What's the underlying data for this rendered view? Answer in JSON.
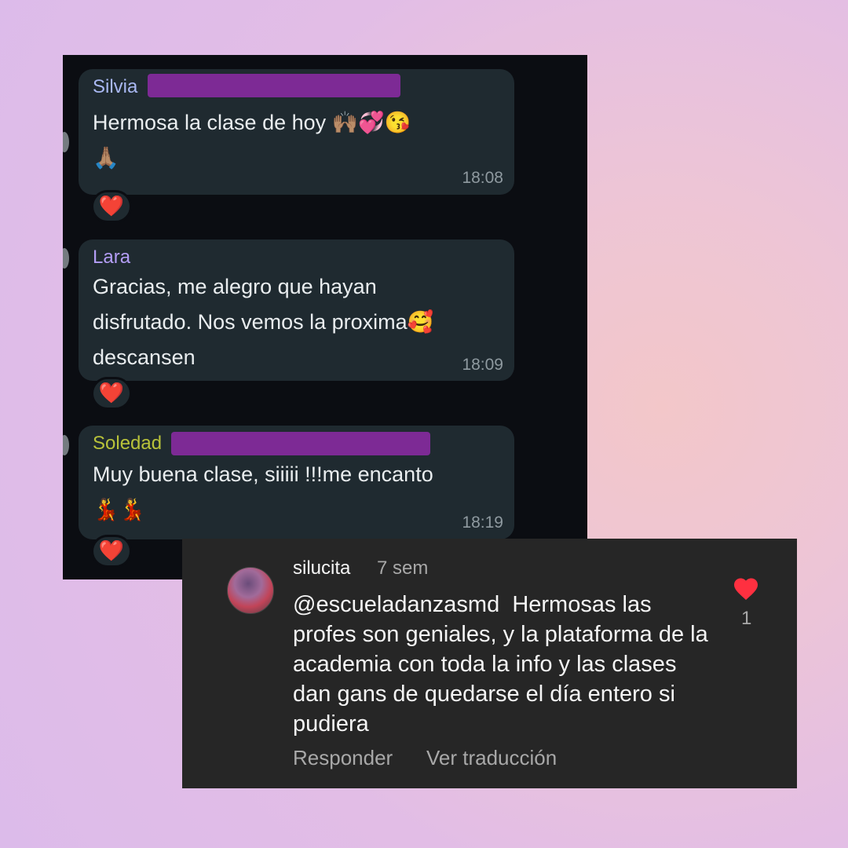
{
  "chat": {
    "messages": [
      {
        "sender": "Silvia",
        "sender_color": "#a9b8f2",
        "text": "Hermosa la clase de hoy 🙌🏽💞😘\n🙏🏽",
        "time": "18:08",
        "reaction": "❤️"
      },
      {
        "sender": "Lara",
        "sender_color": "#b39df5",
        "text": "Gracias, me alegro que hayan\ndisfrutado. Nos vemos la proxima🥰\ndescansen",
        "time": "18:09",
        "reaction": "❤️"
      },
      {
        "sender": "Soledad",
        "sender_color": "#b8c23a",
        "text": "Muy buena clase, siiiii !!!me encanto\n💃💃",
        "time": "18:19",
        "reaction": "❤️"
      }
    ]
  },
  "comment": {
    "username": "silucita",
    "time_ago": "7 sem",
    "mention": "@escueladanzasmd",
    "text": "  Hermosas las profes son geniales, y la plataforma de la academia con toda la info y las clases dan gans de quedarse el día entero si pudiera",
    "likes": "1",
    "heart_icon": "heart-icon",
    "heart_color": "#ff3040",
    "reply_label": "Responder",
    "translate_label": "Ver traducción"
  }
}
